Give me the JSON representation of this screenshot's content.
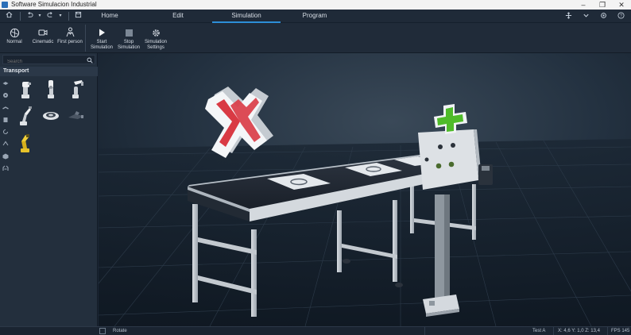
{
  "window": {
    "title": "Software Simulacion Industrial",
    "controls": [
      "–",
      "❐",
      "✕"
    ]
  },
  "quick_access": [
    "home-icon",
    "undo-icon",
    "undo-dropdown-icon",
    "redo-icon",
    "redo-dropdown-icon",
    "save-icon"
  ],
  "tabs": [
    {
      "label": "Home"
    },
    {
      "label": "Edit"
    },
    {
      "label": "Simulation",
      "active": true
    },
    {
      "label": "Program"
    }
  ],
  "top_right_icons": [
    "fit-icon",
    "chevron-down-icon",
    "settings-icon",
    "help-icon"
  ],
  "ribbon": {
    "camera": [
      {
        "label": "Normal",
        "icon": "normal-camera-icon"
      },
      {
        "label": "Cinematic",
        "icon": "cinematic-camera-icon"
      },
      {
        "label": "First person",
        "icon": "first-person-icon"
      }
    ],
    "simulation": [
      {
        "label": "Start Simulation",
        "icon": "play-icon"
      },
      {
        "label": "Stop Simulation",
        "icon": "stop-icon"
      },
      {
        "label": "Simulation Settings",
        "icon": "gear-icon"
      }
    ]
  },
  "library": {
    "search_placeholder": "Search",
    "category": "Transport",
    "side_icons": [
      "conveyor-icon",
      "gear-part-icon",
      "belt-icon",
      "box-icon",
      "rotation-icon",
      "link-icon",
      "cube-icon",
      "gripper-icon"
    ],
    "items": [
      "robot-arm-1",
      "robot-arm-2",
      "robot-arm-3",
      "robot-arm-4",
      "turntable",
      "gripper-tool",
      "yellow-robot-arm"
    ]
  },
  "status": {
    "mode": "Rotate",
    "test": "Test A",
    "coords": "X: 4,6  Y: 1,0  Z: 13,4",
    "fps": "FPS 145"
  },
  "colors": {
    "accent": "#2d8fd8",
    "background": "#1b2635",
    "panel": "#232f3d",
    "cross_red": "#d93a44",
    "plus_green": "#4fbb2a"
  }
}
